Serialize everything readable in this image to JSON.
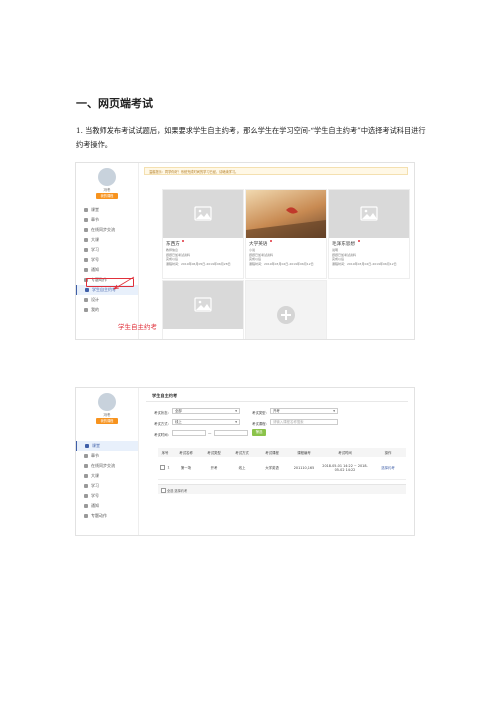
{
  "heading": "一、网页端考试",
  "paragraph": "1. 当教师发布考试试题后，如果要求学生自主约考，那么学生在学习空间-“学生自主约考”中选择考试科目进行约考操作。",
  "shot1": {
    "user_name": "冯冬",
    "user_button": "我的课程",
    "notice": "温馨提示：同学你好！系统完成时间的学习已经，请继续学习。",
    "nav": [
      "课堂",
      "章节",
      "在线同步交流",
      "大课",
      "学习",
      "学号",
      "通知",
      "专题动作",
      "学生自主约考",
      "设计",
      "我的"
    ],
    "active_index": 8,
    "cards": [
      {
        "title": "东西方",
        "lines": [
          "教师信息",
          "题题已加考试资料",
          "完成以后",
          "课程时间：2019年06月05日-2019年06月28日"
        ]
      },
      {
        "title": "大学英语",
        "lines": [
          "小说",
          "题题已加考试资料",
          "完成以后",
          "课程时间：2019年03月02日-2019年06月12日"
        ]
      },
      {
        "title": "毛泽东思想",
        "lines": [
          "说明",
          "题题已加考试资料",
          "完成以后",
          "课程时间：2019年03月02日-2019年06月12日"
        ]
      }
    ],
    "annotation": "学生自主约考"
  },
  "shot2": {
    "user_name": "冯冬",
    "user_button": "我的课程",
    "title": "学生自主约考",
    "nav": [
      "课堂",
      "章节",
      "在线同步交流",
      "大课",
      "学习",
      "学号",
      "通知",
      "专题动作"
    ],
    "active_index": 0,
    "filters": {
      "label1": "考试状态：",
      "value1": "全部",
      "label2": "考试类型：",
      "value2": "开考",
      "label3": "考试方式：",
      "value3": "线上",
      "label4": "考试课程：",
      "placeholder4": "请输入课程名称搜索",
      "label5": "考试时间：",
      "sep": "—",
      "button": "筛选"
    },
    "columns": [
      "序号",
      "考试名称",
      "考试类型",
      "考试方式",
      "考试课程",
      "课程编号",
      "考试时间",
      "操作"
    ],
    "rows": [
      {
        "no": "1",
        "name": "第一场",
        "type": "开考",
        "mode": "线上",
        "course": "大学英语",
        "code": "201110,165",
        "time": "2018-05-01 14:22 ~ 2018-05-02 14:22",
        "op": "选择约考"
      }
    ],
    "footer": "全选  选择约考"
  },
  "colors": {
    "accent": "#f7931e",
    "link": "#3f5fa8",
    "annotation": "#e0303a"
  }
}
